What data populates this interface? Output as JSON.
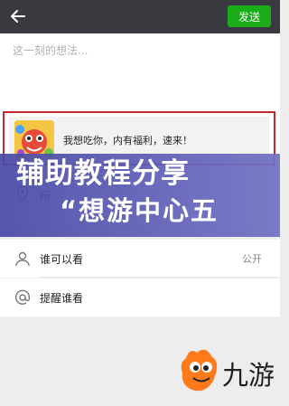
{
  "topbar": {
    "send_label": "发送",
    "color": "#393a3f",
    "send_color": "#1aad19"
  },
  "compose": {
    "placeholder": "这一刻的想法...",
    "share_card": {
      "text": "我想吃你，内有福利，速来！"
    }
  },
  "banner": {
    "line1": "辅助教程分享",
    "line2": "“想游中心五"
  },
  "location": {
    "label": "所"
  },
  "visibility": {
    "label": "谁可以看",
    "value": "公开"
  },
  "remind": {
    "label": "提醒谁看"
  },
  "watermark": {
    "text": "九游",
    "color": "#ff7a1a"
  },
  "accent": {
    "frame": "#c3282c",
    "banner": "#5a5bb4"
  }
}
